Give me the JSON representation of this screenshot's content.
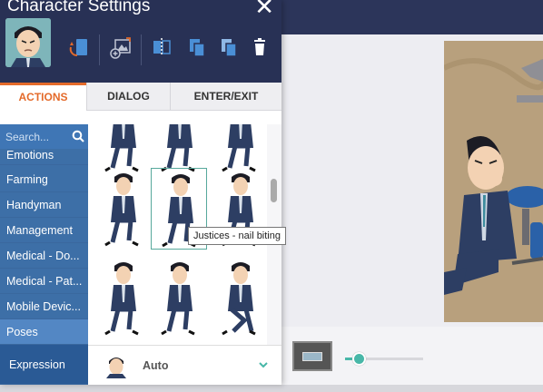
{
  "panel": {
    "title": "Character Settings",
    "close_glyph": "✕"
  },
  "tabs": [
    {
      "label": "ACTIONS",
      "active": true
    },
    {
      "label": "DIALOG",
      "active": false
    },
    {
      "label": "ENTER/EXIT",
      "active": false
    }
  ],
  "search": {
    "placeholder": "Search..."
  },
  "categories": [
    {
      "label": "Emotions"
    },
    {
      "label": "Farming"
    },
    {
      "label": "Handyman"
    },
    {
      "label": "Management"
    },
    {
      "label": "Medical - Do..."
    },
    {
      "label": "Medical - Pat..."
    },
    {
      "label": "Mobile Devic..."
    },
    {
      "label": "Poses",
      "selected": true
    }
  ],
  "expression": {
    "label": "Expression",
    "value": "Auto"
  },
  "tooltip": "Justices - nail biting",
  "zoom": {
    "level": 0.18
  },
  "colors": {
    "header": "#283155",
    "accent": "#e46a2a",
    "sidebar": "#3d6fa7",
    "selected_border": "#57a89c",
    "slider": "#48b7a8"
  },
  "icons": [
    "swap-character-icon",
    "copy-icon",
    "add-asset-icon",
    "flip-icon",
    "duplicate-icon",
    "paste-icon",
    "trash-icon",
    "search-icon",
    "chevron-down-icon"
  ]
}
